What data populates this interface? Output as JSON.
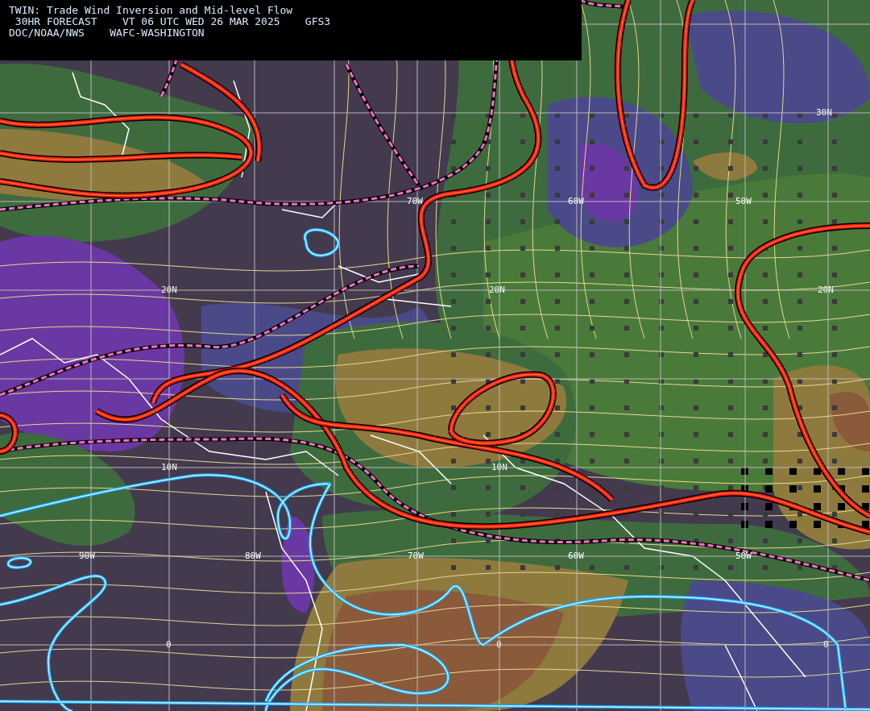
{
  "header": {
    "lines": [
      "TWIN: Trade Wind Inversion and Mid-level Flow",
      " 30HR FORECAST    VT 06 UTC WED 26 MAR 2025    GFS3",
      "DOC/NOAA/NWS    WAFC-WASHINGTON"
    ]
  },
  "map": {
    "grid_labels": [
      {
        "kind": "lat",
        "text": "30N"
      },
      {
        "kind": "lon",
        "text": "70W"
      },
      {
        "kind": "lon",
        "text": "60W"
      },
      {
        "kind": "lon",
        "text": "50W"
      },
      {
        "kind": "lat",
        "text": "20N"
      },
      {
        "kind": "lat",
        "text": "20N"
      },
      {
        "kind": "lat",
        "text": "20N"
      },
      {
        "kind": "lat",
        "text": "10N"
      },
      {
        "kind": "lat",
        "text": "10N"
      },
      {
        "kind": "lon",
        "text": "90W"
      },
      {
        "kind": "lon",
        "text": "80W"
      },
      {
        "kind": "lon",
        "text": "70W"
      },
      {
        "kind": "lon",
        "text": "60W"
      },
      {
        "kind": "lon",
        "text": "50W"
      },
      {
        "kind": "lat",
        "text": "0"
      },
      {
        "kind": "lat",
        "text": "0"
      },
      {
        "kind": "lat",
        "text": "0"
      }
    ]
  }
}
